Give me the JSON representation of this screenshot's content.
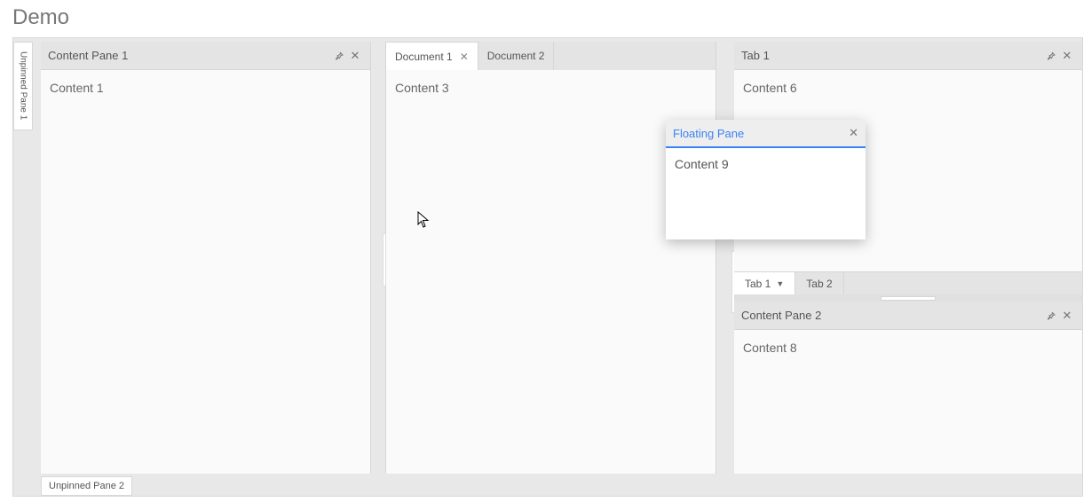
{
  "page": {
    "title": "Demo"
  },
  "unpinned": {
    "left": "Unpinned Pane 1",
    "bottom": "Unpinned Pane 2"
  },
  "leftPane": {
    "title": "Content Pane 1",
    "body": "Content 1"
  },
  "documents": {
    "tabs": [
      {
        "label": "Document 1",
        "active": true
      },
      {
        "label": "Document 2",
        "active": false
      }
    ],
    "body": "Content 3"
  },
  "rightTop": {
    "header": "Tab 1",
    "body": "Content 6",
    "bottomTabs": [
      {
        "label": "Tab 1",
        "active": true,
        "dropdown": true
      },
      {
        "label": "Tab 2",
        "active": false,
        "dropdown": false
      }
    ]
  },
  "rightBottom": {
    "title": "Content Pane 2",
    "body": "Content 8"
  },
  "floating": {
    "title": "Floating Pane",
    "body": "Content 9"
  }
}
